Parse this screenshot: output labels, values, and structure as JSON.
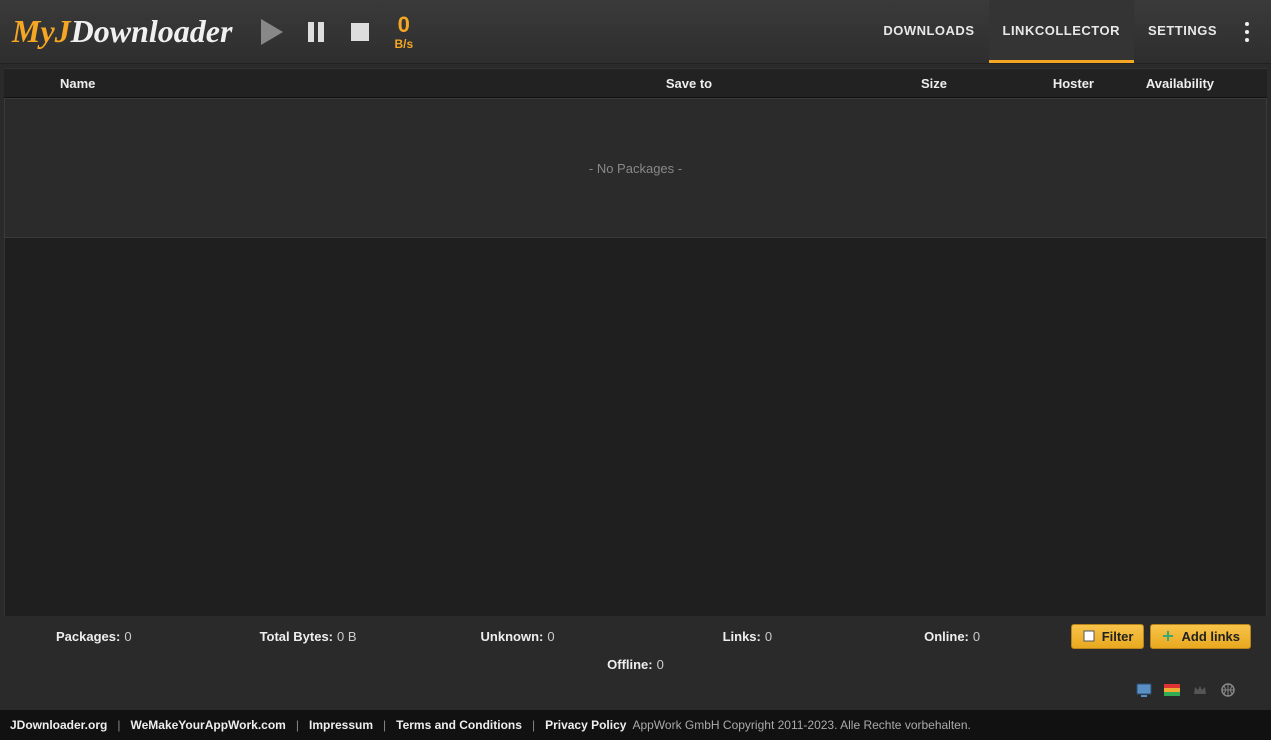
{
  "logo": {
    "my": "My",
    "j": "J",
    "dl": "Downloader"
  },
  "speed": {
    "value": "0",
    "unit": "B/s"
  },
  "tabs": {
    "downloads": "DOWNLOADS",
    "linkcollector": "LINKCOLLECTOR",
    "settings": "SETTINGS"
  },
  "columns": {
    "name": "Name",
    "saveto": "Save to",
    "size": "Size",
    "hoster": "Hoster",
    "availability": "Availability"
  },
  "empty_message": "- No Packages -",
  "stats": {
    "packages_label": "Packages:",
    "packages_value": "0",
    "totalbytes_label": "Total Bytes:",
    "totalbytes_value": "0 B",
    "unknown_label": "Unknown:",
    "unknown_value": "0",
    "links_label": "Links:",
    "links_value": "0",
    "online_label": "Online:",
    "online_value": "0",
    "offline_label": "Offline:",
    "offline_value": "0"
  },
  "buttons": {
    "filter": "Filter",
    "addlinks": "Add links"
  },
  "footer": {
    "link1": "JDownloader.org",
    "link2": "WeMakeYourAppWork.com",
    "link3": "Impressum",
    "link4": "Terms and Conditions",
    "link5": "Privacy Policy",
    "copyright": "AppWork GmbH Copyright 2011-2023. Alle Rechte vorbehalten."
  }
}
